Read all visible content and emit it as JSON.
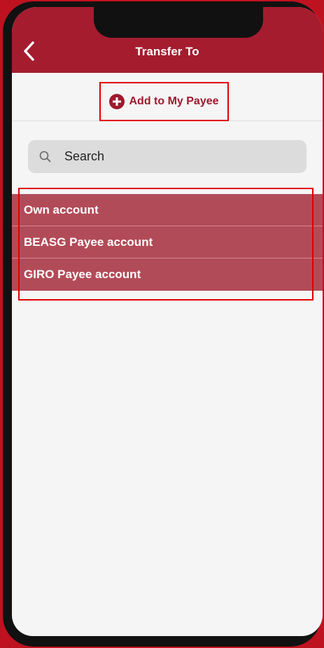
{
  "header": {
    "title": "Transfer To",
    "back_icon": "chevron-left-icon"
  },
  "add_payee": {
    "label": "Add to My Payee",
    "icon": "plus-circle-icon",
    "color": "#9e1a2c"
  },
  "search": {
    "placeholder": "Search",
    "value": "",
    "icon": "search-icon"
  },
  "accounts": [
    {
      "label": "Own account"
    },
    {
      "label": "BEASG Payee account"
    },
    {
      "label": "GIRO Payee account"
    }
  ],
  "colors": {
    "header_bg": "#a51c2f",
    "list_item_bg": "#b24b58",
    "highlight_border": "#e00000"
  }
}
